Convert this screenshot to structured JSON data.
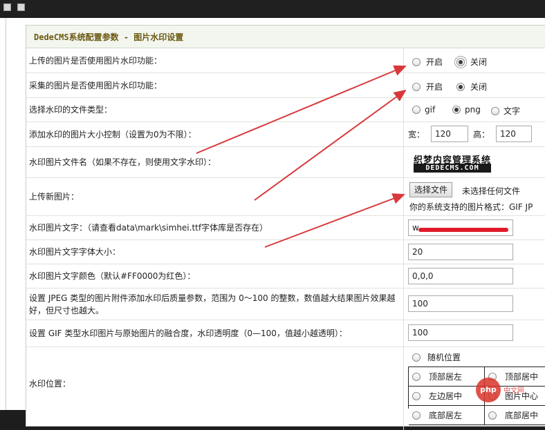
{
  "header": {
    "title": "DedeCMS系统配置参数 - 图片水印设置"
  },
  "rows": [
    {
      "label": "上传的图片是否使用图片水印功能：",
      "options": [
        {
          "label": "开启",
          "checked": false
        },
        {
          "label": "关闭",
          "checked": true
        }
      ]
    },
    {
      "label": "采集的图片是否使用图片水印功能：",
      "options": [
        {
          "label": "开启",
          "checked": false
        },
        {
          "label": "关闭",
          "checked": true
        }
      ]
    },
    {
      "label": "选择水印的文件类型：",
      "options": [
        {
          "label": "gif",
          "checked": false
        },
        {
          "label": "png",
          "checked": true
        },
        {
          "label": "文字",
          "checked": false
        }
      ]
    },
    {
      "label": "添加水印的图片大小控制（设置为0为不限）：",
      "width_label": "宽：",
      "width_value": "120",
      "height_label": "高：",
      "height_value": "120"
    },
    {
      "label": "水印图片文件名（如果不存在，则使用文字水印）：",
      "logo_top": "织梦内容管理系统",
      "logo_bottom": "DEDECMS.COM"
    },
    {
      "label": "上传新图片：",
      "file_button": "选择文件",
      "file_status": "未选择任何文件",
      "formats_note": "你的系统支持的图片格式：GIF JP"
    },
    {
      "label": "水印图片文字：（请查看data\\mark\\simhei.ttf字体库是否存在）",
      "value": "w"
    },
    {
      "label": "水印图片文字字体大小：",
      "value": "20"
    },
    {
      "label": "水印图片文字颜色（默认#FF0000为红色）：",
      "value": "0,0,0"
    },
    {
      "label": "设置 JPEG 类型的图片附件添加水印后质量参数，范围为 0～100 的整数，数值越大结果图片效果越好，但尺寸也越大。",
      "value": "100"
    },
    {
      "label": "设置 GIF 类型水印图片与原始图片的融合度，水印透明度（0—100，值越小越透明）：",
      "value": "100"
    },
    {
      "label": "水印位置：",
      "random_label": "随机位置",
      "positions": [
        "顶部居左",
        "顶部居中",
        "左边居中",
        "图片中心",
        "底部居左",
        "底部居中"
      ]
    }
  ],
  "watermark": {
    "mark": "php",
    "text": "中文网"
  },
  "colors": {
    "arrow": "#d8383c",
    "title": "#6b5a12",
    "redaction": "#e01a2a"
  }
}
